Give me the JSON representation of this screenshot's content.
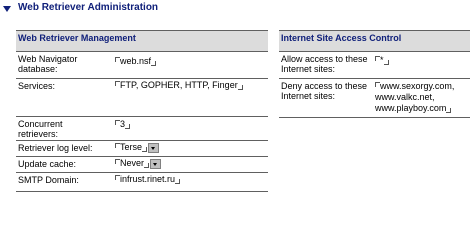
{
  "section": {
    "title": "Web Retriever Administration"
  },
  "left_panel": {
    "heading": "Web Retriever Management",
    "rows": [
      {
        "label": "Web Navigator database:",
        "value": "web.nsf"
      },
      {
        "label": "Services:",
        "value": "FTP, GOPHER, HTTP, Finger"
      },
      {
        "label": "Concurrent retrievers:",
        "value": "3"
      },
      {
        "label": "Retriever log level:",
        "value": "Terse"
      },
      {
        "label": "Update cache:",
        "value": "Never"
      },
      {
        "label": "SMTP Domain:",
        "value": "infrust.rinet.ru"
      }
    ]
  },
  "right_panel": {
    "heading": "Internet Site Access Control",
    "rows": [
      {
        "label": "Allow access to these Internet sites:",
        "value": "*"
      },
      {
        "label": "Deny access to these Internet sites:",
        "values": [
          "www.sexorgy.com,",
          "www.valkc.net,",
          "www.playboy.com"
        ]
      }
    ]
  }
}
